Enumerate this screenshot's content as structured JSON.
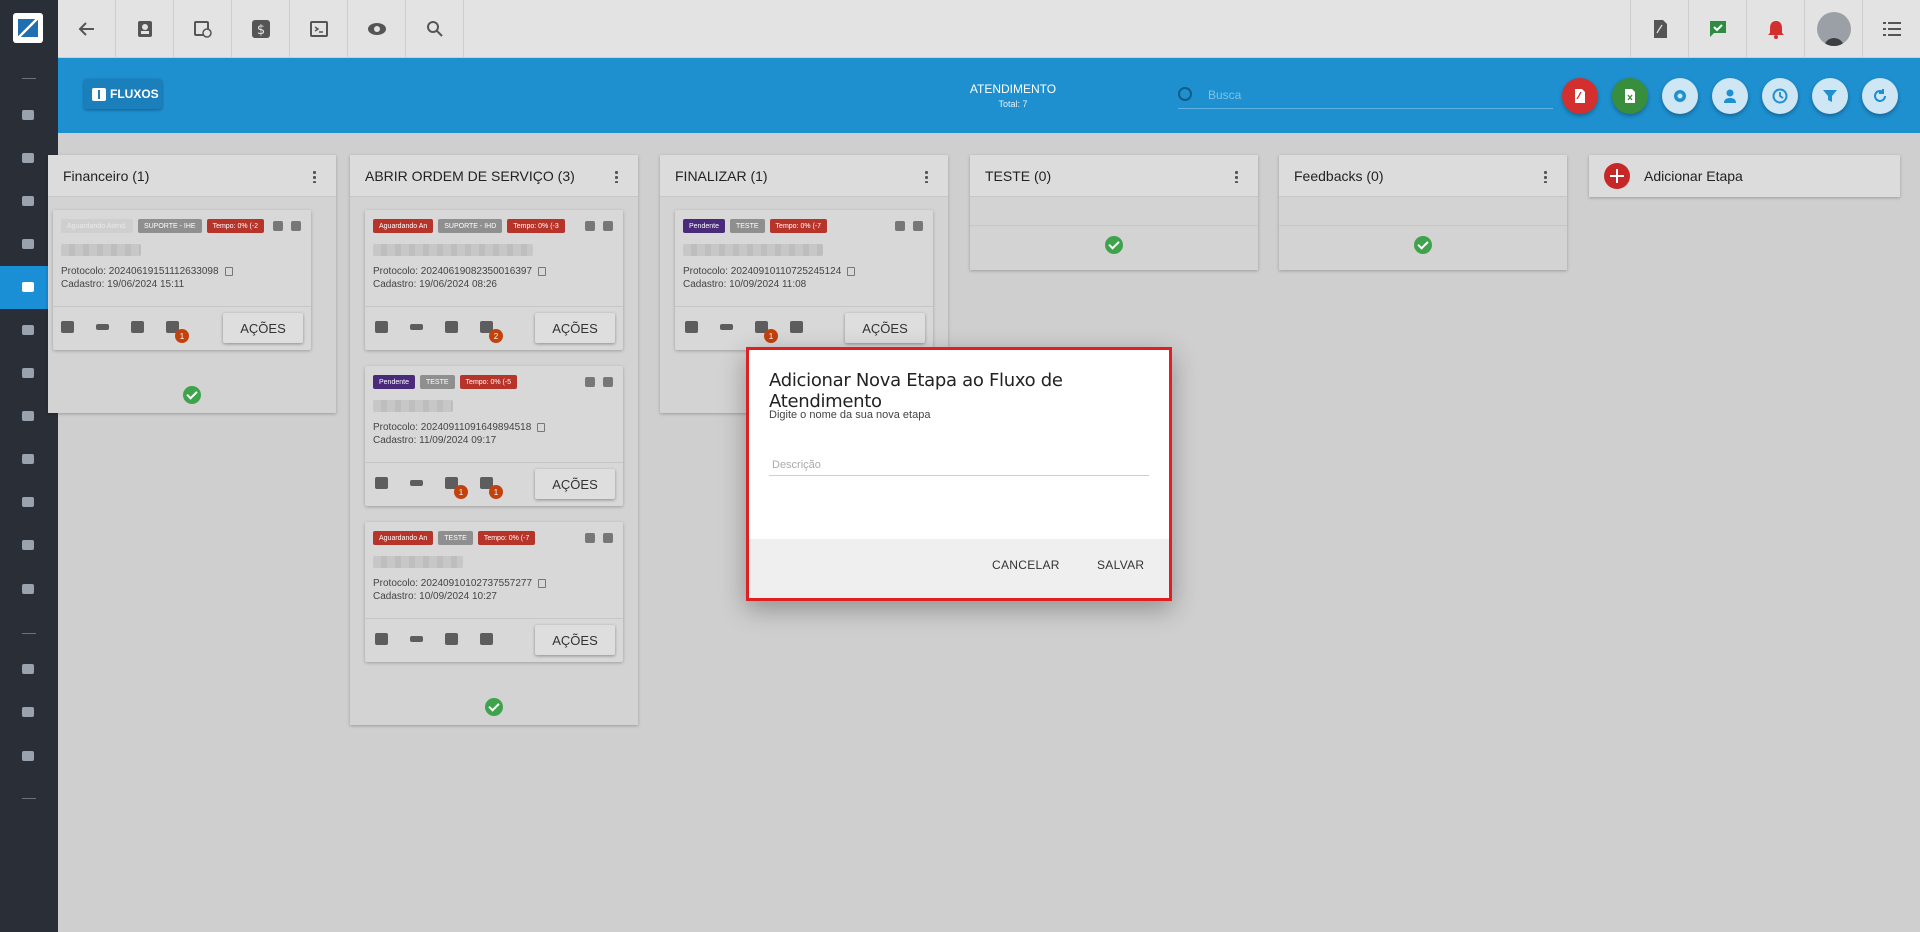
{
  "topbar": {
    "icons": [
      "back-arrow-icon",
      "contact-card-icon",
      "calendar-clock-icon",
      "dollar-icon",
      "terminal-icon",
      "eye-icon",
      "search-icon"
    ],
    "right_icons": [
      "pdf-icon",
      "chat-check-icon",
      "alarm-bell-icon",
      "user-avatar",
      "list-menu-icon"
    ]
  },
  "header": {
    "button_label": "FLUXOS",
    "title": "ATENDIMENTO",
    "total": "Total: 7",
    "search_placeholder": "Busca",
    "action_colors": {
      "pdf": "#d32f2f",
      "excel": "#388e3c",
      "default": "#cfe6f4"
    }
  },
  "columns": [
    {
      "title": "Financeiro (1)",
      "cards": [
        {
          "tags": [
            {
              "text": "Aguardando Atend.",
              "style": "pale"
            },
            {
              "text": "SUPORTE - IHE",
              "style": "grey"
            },
            {
              "text": "Tempo: 0% (-2",
              "style": "red"
            }
          ],
          "protocolo": "Protocolo: 20240619151112633098",
          "cadastro": "Cadastro: 19/06/2024 15:11",
          "badges": {
            "people": "1"
          },
          "action": "AÇÕES"
        }
      ]
    },
    {
      "title": "ABRIR ORDEM DE SERVIÇO (3)",
      "cards": [
        {
          "tags": [
            {
              "text": "Aguardando An",
              "style": "red"
            },
            {
              "text": "SUPORTE - IHD",
              "style": "grey"
            },
            {
              "text": "Tempo: 0% (-3",
              "style": "red"
            }
          ],
          "protocolo": "Protocolo: 20240619082350016397",
          "cadastro": "Cadastro: 19/06/2024 08:26",
          "badges": {
            "people": "2"
          },
          "action": "AÇÕES"
        },
        {
          "tags": [
            {
              "text": "Pendente",
              "style": "purple"
            },
            {
              "text": "TESTE",
              "style": "grey"
            },
            {
              "text": "Tempo: 0% (-5",
              "style": "red"
            }
          ],
          "protocolo": "Protocolo: 20240911091649894518",
          "cadastro": "Cadastro: 11/09/2024 09:17",
          "badges": {
            "doc": "1",
            "people": "1"
          },
          "action": "AÇÕES"
        },
        {
          "tags": [
            {
              "text": "Aguardando An",
              "style": "red"
            },
            {
              "text": "TESTE",
              "style": "grey"
            },
            {
              "text": "Tempo: 0% (-7",
              "style": "red"
            }
          ],
          "protocolo": "Protocolo: 20240910102737557277",
          "cadastro": "Cadastro: 10/09/2024 10:27",
          "badges": {},
          "action": "AÇÕES"
        }
      ]
    },
    {
      "title": "FINALIZAR (1)",
      "cards": [
        {
          "tags": [
            {
              "text": "Pendente",
              "style": "purple"
            },
            {
              "text": "TESTE",
              "style": "grey"
            },
            {
              "text": "Tempo: 0% (-7",
              "style": "red"
            }
          ],
          "protocolo": "Protocolo: 20240910110725245124",
          "cadastro": "Cadastro: 10/09/2024 11:08",
          "badges": {
            "doc": "1"
          },
          "action": "AÇÕES"
        }
      ]
    },
    {
      "title": "TESTE (0)",
      "cards": []
    },
    {
      "title": "Feedbacks (0)",
      "cards": []
    }
  ],
  "add_stage": {
    "label": "Adicionar Etapa"
  },
  "dialog": {
    "title": "Adicionar Nova Etapa ao Fluxo de Atendimento",
    "subtitle": "Digite o nome da sua nova etapa",
    "input_placeholder": "Descrição",
    "input_value": "",
    "cancel_label": "CANCELAR",
    "save_label": "SALVAR"
  }
}
